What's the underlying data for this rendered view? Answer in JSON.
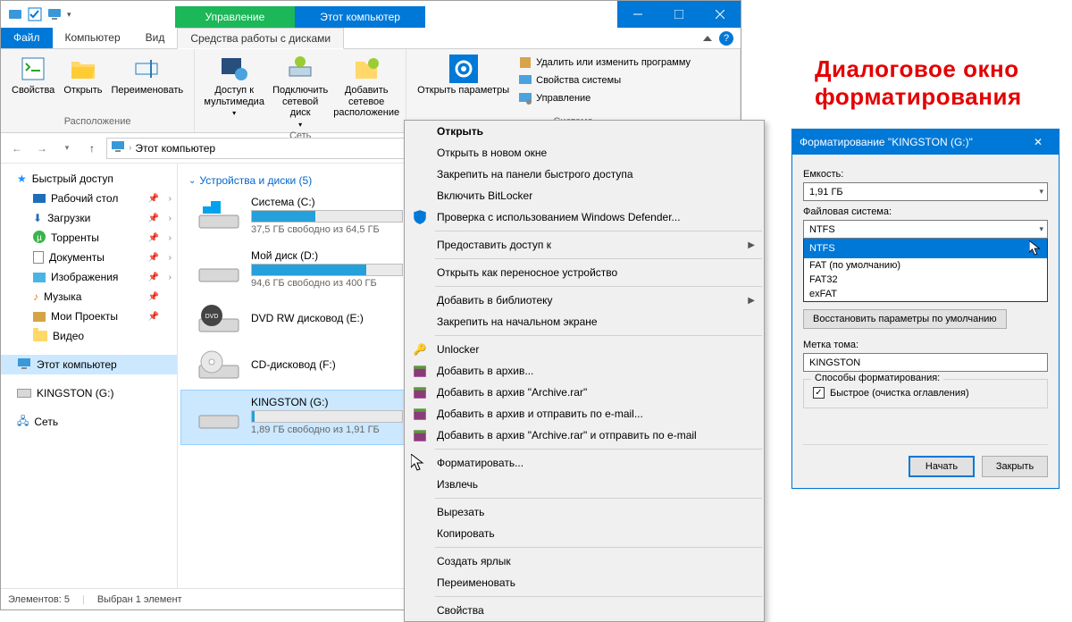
{
  "titlebar": {
    "tab_manage": "Управление",
    "tab_title": "Этот компьютер"
  },
  "menu": {
    "file": "Файл",
    "computer": "Компьютер",
    "view": "Вид",
    "tools": "Средства работы с дисками"
  },
  "ribbon": {
    "g1": {
      "name": "Расположение",
      "props": "Свойства",
      "open": "Открыть",
      "rename": "Переименовать"
    },
    "g2": {
      "name": "Сеть",
      "media": "Доступ к мультимедиа",
      "mapdrive": "Подключить сетевой диск",
      "addnet": "Добавить сетевое расположение"
    },
    "g3": {
      "name": "Система",
      "params": "Открыть параметры",
      "r1": "Удалить или изменить программу",
      "r2": "Свойства системы",
      "r3": "Управление"
    }
  },
  "addr": {
    "text": "Этот компьютер"
  },
  "nav": {
    "quick": "Быстрый доступ",
    "desktop": "Рабочий стол",
    "downloads": "Загрузки",
    "torrents": "Торренты",
    "documents": "Документы",
    "pictures": "Изображения",
    "music": "Музыка",
    "projects": "Мои Проекты",
    "video": "Видео",
    "thispc": "Этот компьютер",
    "kingston": "KINGSTON (G:)",
    "network": "Сеть"
  },
  "content": {
    "header": "Устройства и диски (5)",
    "drives": [
      {
        "name": "Система (C:)",
        "sub": "37,5 ГБ свободно из 64,5 ГБ",
        "fill": 42
      },
      {
        "name": "Мой диск (D:)",
        "sub": "94,6 ГБ свободно из 400 ГБ",
        "fill": 76
      },
      {
        "name": "DVD RW дисковод (E:)",
        "sub": "",
        "fill": -1
      },
      {
        "name": "CD-дисковод (F:)",
        "sub": "",
        "fill": -1
      },
      {
        "name": "KINGSTON (G:)",
        "sub": "1,89 ГБ свободно из 1,91 ГБ",
        "fill": 2
      }
    ]
  },
  "status": {
    "count": "Элементов: 5",
    "sel": "Выбран 1 элемент"
  },
  "ctx": {
    "open": "Открыть",
    "new_win": "Открыть в новом окне",
    "pin_quick": "Закрепить на панели быстрого доступа",
    "bitlocker": "Включить BitLocker",
    "defender": "Проверка с использованием Windows Defender...",
    "share": "Предоставить доступ к",
    "portable": "Открыть как переносное устройство",
    "library": "Добавить в библиотеку",
    "pin_start": "Закрепить на начальном экране",
    "unlocker": "Unlocker",
    "rar1": "Добавить в архив...",
    "rar2": "Добавить в архив \"Archive.rar\"",
    "rar3": "Добавить в архив и отправить по e-mail...",
    "rar4": "Добавить в архив \"Archive.rar\" и отправить по e-mail",
    "format": "Форматировать...",
    "eject": "Извлечь",
    "cut": "Вырезать",
    "copy": "Копировать",
    "shortcut": "Создать ярлык",
    "rename": "Переименовать",
    "props": "Свойства"
  },
  "heading": "Диалоговое окно\nформатирования",
  "dlg": {
    "title": "Форматирование \"KINGSTON (G:)\"",
    "cap_label": "Емкость:",
    "cap_val": "1,91 ГБ",
    "fs_label": "Файловая система:",
    "fs_val": "NTFS",
    "fs_opts": [
      "NTFS",
      "FAT (по умолчанию)",
      "FAT32",
      "exFAT"
    ],
    "restore": "Восстановить параметры по умолчанию",
    "vol_label": "Метка тома:",
    "vol_val": "KINGSTON",
    "ways": "Способы форматирования:",
    "quick": "Быстрое (очистка оглавления)",
    "start": "Начать",
    "close": "Закрыть"
  }
}
